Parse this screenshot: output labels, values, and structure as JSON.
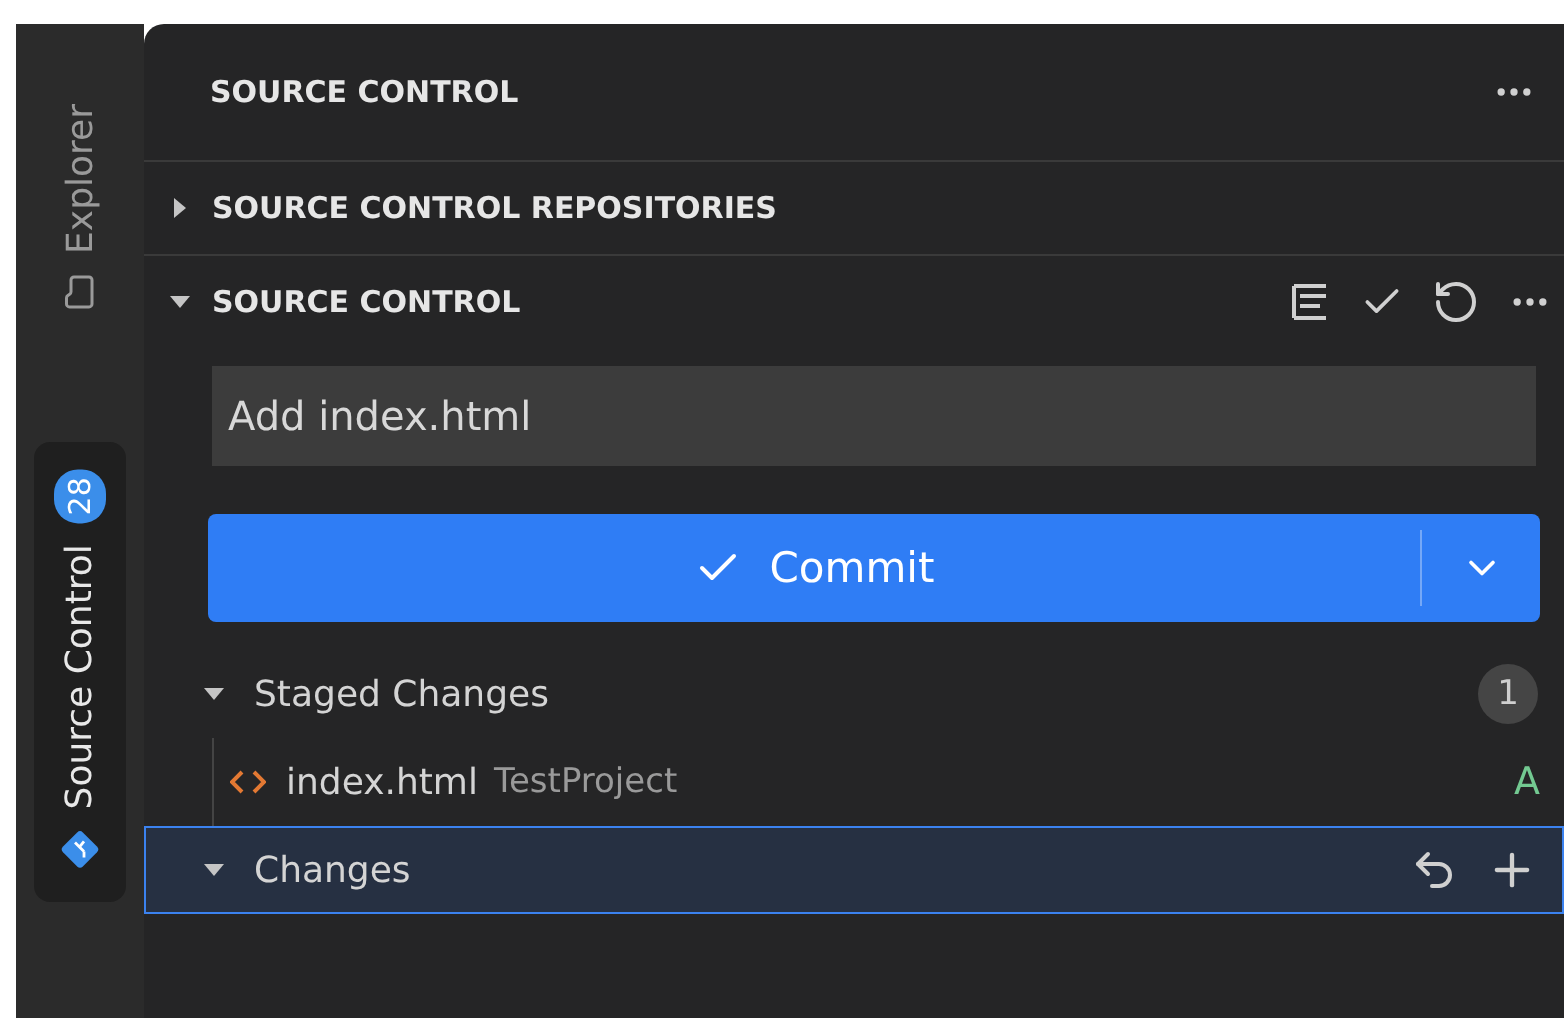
{
  "activity_bar": {
    "items": [
      {
        "label": "Explorer",
        "kind": "explorer",
        "selected": false
      },
      {
        "label": "Source Control",
        "kind": "scm",
        "selected": true,
        "badge": "28"
      }
    ]
  },
  "panel": {
    "title": "SOURCE CONTROL",
    "sections": [
      {
        "title": "SOURCE CONTROL REPOSITORIES",
        "expanded": false
      },
      {
        "title": "SOURCE CONTROL",
        "expanded": true
      }
    ],
    "message": {
      "value": "Add index.html"
    },
    "commit_button": {
      "label": "Commit"
    },
    "groups": [
      {
        "label": "Staged Changes",
        "expanded": true,
        "selected": false,
        "count": "1",
        "kind": "staged",
        "files": [
          {
            "name": "index.html",
            "folder": "TestProject",
            "status": "A"
          }
        ]
      },
      {
        "label": "Changes",
        "expanded": true,
        "selected": true,
        "kind": "changes"
      }
    ]
  }
}
